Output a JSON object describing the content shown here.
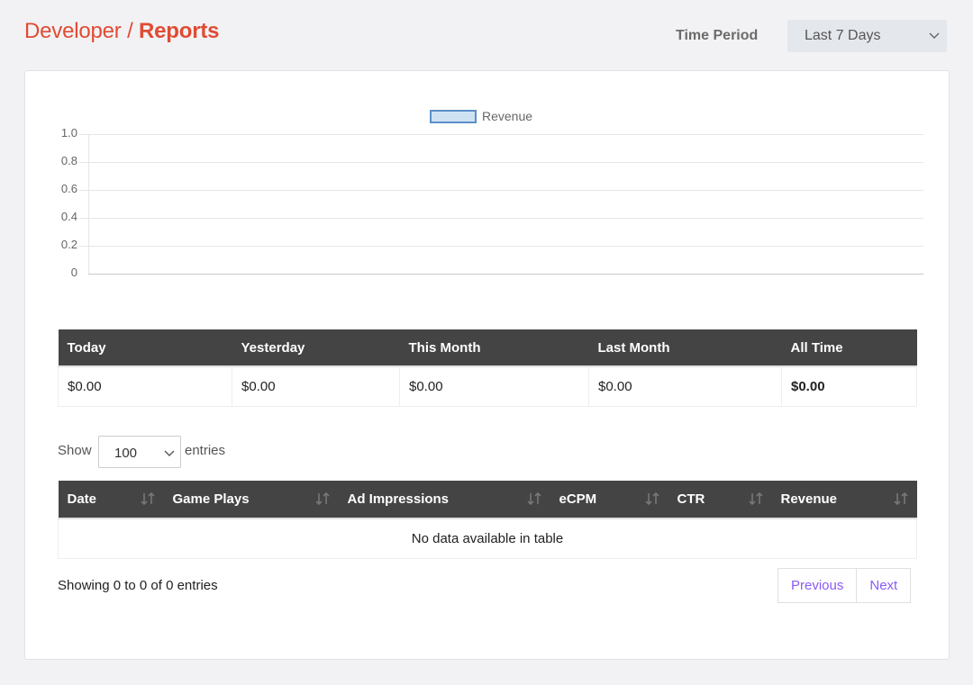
{
  "header": {
    "breadcrumb_parent": "Developer",
    "breadcrumb_sep": " / ",
    "breadcrumb_current": "Reports",
    "time_period_label": "Time Period",
    "time_period_value": "Last 7 Days"
  },
  "chart_data": {
    "type": "bar",
    "title": "",
    "legend": [
      "Revenue"
    ],
    "legend_placement": "top-center",
    "categories": [],
    "series": [
      {
        "name": "Revenue",
        "values": []
      }
    ],
    "yticks": [
      "1.0",
      "0.8",
      "0.6",
      "0.4",
      "0.2",
      "0"
    ],
    "ylim": [
      0,
      1.0
    ],
    "grid": true,
    "colors": {
      "fill": "#cfe2f3",
      "border": "#5b8fc9"
    }
  },
  "summary": {
    "headers": [
      "Today",
      "Yesterday",
      "This Month",
      "Last Month",
      "All Time"
    ],
    "values": [
      "$0.00",
      "$0.00",
      "$0.00",
      "$0.00",
      "$0.00"
    ]
  },
  "length_control": {
    "show_label": "Show",
    "value": "100",
    "entries_label": "entries"
  },
  "datatable": {
    "headers": [
      "Date",
      "Game Plays",
      "Ad Impressions",
      "eCPM",
      "CTR",
      "Revenue"
    ],
    "empty_message": "No data available in table",
    "info": "Showing 0 to 0 of 0 entries",
    "prev_label": "Previous",
    "next_label": "Next"
  },
  "colors": {
    "brand": "#e04b34",
    "header_bg": "#444444",
    "link": "#8a5cf6"
  }
}
